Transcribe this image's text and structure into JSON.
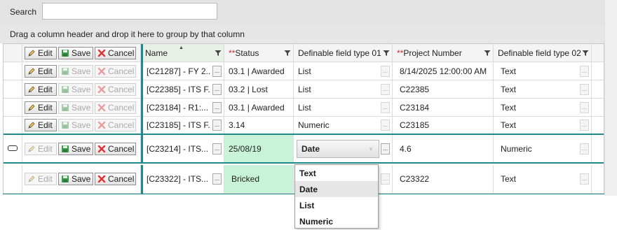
{
  "search": {
    "label": "Search",
    "value": "",
    "placeholder": ""
  },
  "group_panel": {
    "text": "Drag a column header and drop it here to group by that column"
  },
  "buttons": {
    "edit": "Edit",
    "save": "Save",
    "cancel": "Cancel",
    "ellipsis": "..."
  },
  "columns": {
    "name": "Name",
    "status": "Status",
    "status_required": "**",
    "dft01": "Definable field type 01",
    "project_number": "Project Number",
    "project_number_required": "**",
    "dft02": "Definable field type 02"
  },
  "rows": [
    {
      "name": "[C21287] - FY 2...",
      "status": "03.1 | Awarded",
      "dft01": "List",
      "project_number": "8/14/2025 12:00:00 AM",
      "dft02": "Text"
    },
    {
      "name": "[C22385] - ITS F...",
      "status": "03.2 | Lost",
      "dft01": "List",
      "project_number": "C22385",
      "dft02": "Text"
    },
    {
      "name": "[C23184] - R1:...",
      "status": "03.1 | Awarded",
      "dft01": "List",
      "project_number": "C23184",
      "dft02": "Text"
    },
    {
      "name": "[C23185] - ITS F...",
      "status": "3.14",
      "dft01": "Numeric",
      "project_number": "C23185",
      "dft02": "Text"
    },
    {
      "name": "[C23214] - ITS...",
      "status": "25/08/19",
      "dft01": "Date",
      "project_number": "4.6",
      "dft02": "Numeric"
    },
    {
      "name": "[C23322] - ITS...",
      "status": "Bricked",
      "dft01": "",
      "project_number": "C23322",
      "dft02": "Text"
    }
  ],
  "dropdown": {
    "options": [
      "Text",
      "Date",
      "List",
      "Numeric"
    ],
    "highlighted": "Date"
  },
  "colors": {
    "teal": "#1f8a8a",
    "edit_green": "#c8f3d8",
    "required_red": "#d12a2a"
  },
  "icons": [
    "pencil-icon",
    "floppy-disk-icon",
    "red-x-icon",
    "filter-icon",
    "sort-ascending-icon",
    "row-editing-indicator-icon"
  ]
}
